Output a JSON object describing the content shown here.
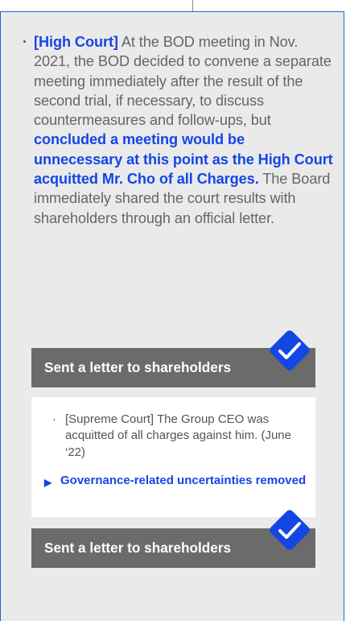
{
  "high_court": {
    "bullet": "·",
    "tag": "[High Court]",
    "text_1": " At the BOD meeting in Nov. 2021, the BOD decided to convene a separate meeting immediately after the result of the second trial, if necessary, to discuss countermeasures and follow-ups, but ",
    "highlight": "concluded a meeting would be unnecessary at this point as the High Court acquitted Mr. Cho of all Charges.",
    "text_2": " The Board immediately shared the court results with shareholders through an official letter."
  },
  "letter_bar_1": {
    "label": "Sent a letter to shareholders"
  },
  "supreme_court": {
    "bullet": "·",
    "text": "[Supreme Court] The Group CEO was acquitted of all charges against him. (June ‘22)",
    "arrow": "▶",
    "outcome": "Governance-related uncertainties removed"
  },
  "letter_bar_2": {
    "label": "Sent a letter to shareholders"
  },
  "colors": {
    "accent_blue": "#1446e6",
    "bar_gray": "#6b6b6b",
    "panel_gray": "#eaeaea",
    "text_gray": "#666666"
  }
}
